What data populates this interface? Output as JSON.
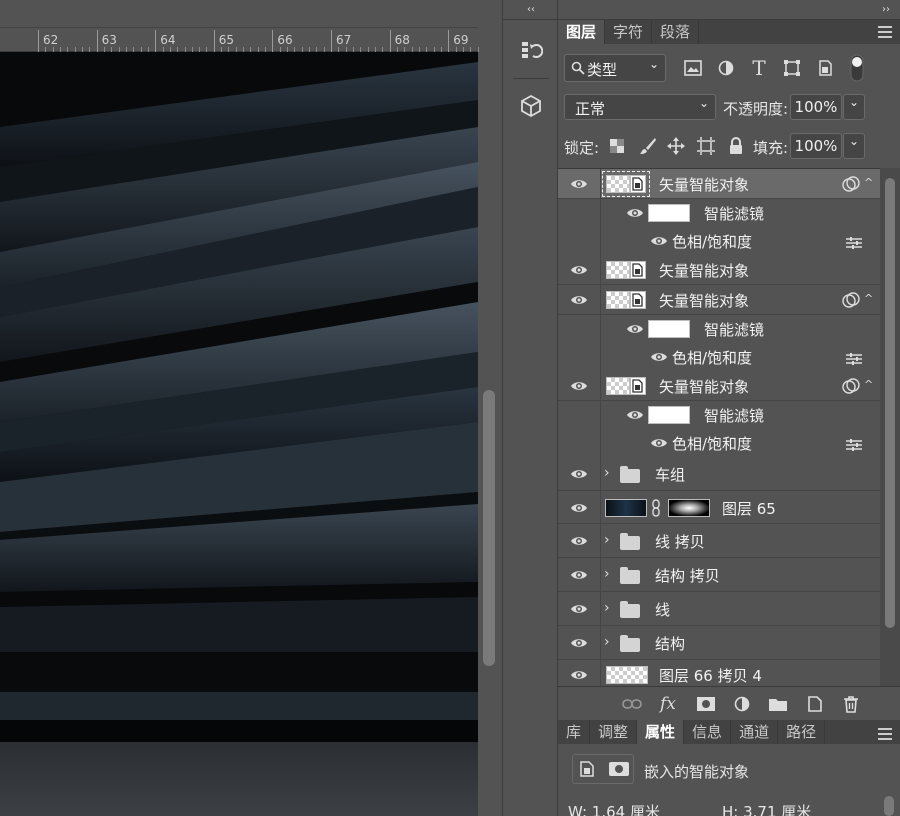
{
  "ruler": {
    "ticks": [
      "62",
      "63",
      "64",
      "65",
      "66",
      "67",
      "68",
      "69"
    ]
  },
  "toolstrip": {
    "collapse_label": "‹‹"
  },
  "panel": {
    "collapse_label": "››",
    "top_tabs": [
      "图层",
      "字符",
      "段落"
    ],
    "filter": {
      "label": "类型",
      "icon": "search-icon"
    },
    "blend_mode": "正常",
    "opacity_label": "不透明度:",
    "opacity_value": "100%",
    "lock_label": "锁定:",
    "fill_label": "填充:",
    "fill_value": "100%"
  },
  "layers": [
    {
      "type": "smart",
      "name": "矢量智能对象",
      "selected": true
    },
    {
      "type": "filter-header",
      "name": "智能滤镜"
    },
    {
      "type": "filter",
      "name": "色相/饱和度"
    },
    {
      "type": "smart-plain",
      "name": "矢量智能对象"
    },
    {
      "type": "smart",
      "name": "矢量智能对象"
    },
    {
      "type": "filter-header",
      "name": "智能滤镜"
    },
    {
      "type": "filter",
      "name": "色相/饱和度"
    },
    {
      "type": "smart",
      "name": "矢量智能对象"
    },
    {
      "type": "filter-header",
      "name": "智能滤镜"
    },
    {
      "type": "filter",
      "name": "色相/饱和度"
    },
    {
      "type": "group",
      "name": "车组"
    },
    {
      "type": "masked",
      "name": "图层 65"
    },
    {
      "type": "group",
      "name": "线 拷贝"
    },
    {
      "type": "group",
      "name": "结构 拷贝"
    },
    {
      "type": "group",
      "name": "线"
    },
    {
      "type": "group",
      "name": "结构"
    },
    {
      "type": "pixel",
      "name": "图层 66 拷贝 4"
    }
  ],
  "bottom_tabs": [
    "库",
    "调整",
    "属性",
    "信息",
    "通道",
    "路径"
  ],
  "bottom_active": "属性",
  "properties": {
    "title": "嵌入的智能对象",
    "w_label": "W: 1.64 厘米",
    "h_label": "H: 3.71 厘米"
  },
  "colors": {
    "panel": "#535353",
    "tab_bar": "#424242",
    "selected_row": "#6a6a6a",
    "canvas_dark": "#0c0f12"
  }
}
